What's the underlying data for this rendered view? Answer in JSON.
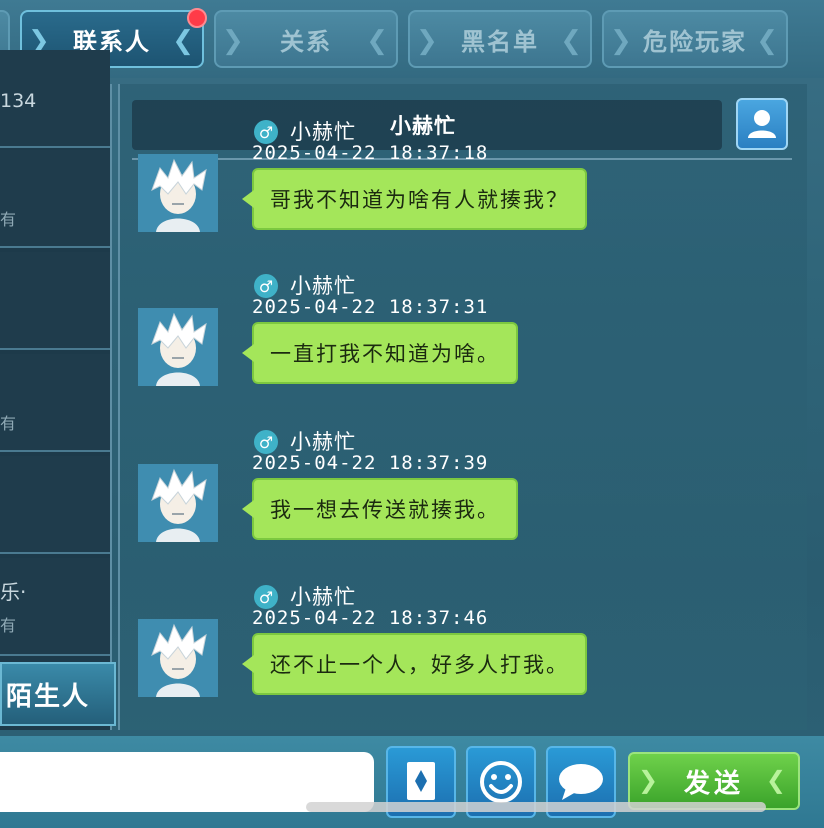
{
  "tabs": [
    {
      "label": "联系人",
      "active": true,
      "has_notification": true
    },
    {
      "label": "关系",
      "active": false
    },
    {
      "label": "黑名单",
      "active": false
    },
    {
      "label": "危险玩家",
      "active": false
    }
  ],
  "contacts": {
    "rows": [
      {
        "text": "134",
        "sub": ""
      },
      {
        "text": "",
        "sub": "有"
      },
      {
        "text": "",
        "sub": ""
      },
      {
        "text": "",
        "sub": "有"
      },
      {
        "text": "",
        "sub": ""
      },
      {
        "text": "乐·",
        "sub": "有"
      }
    ],
    "stranger_button": "陌生人"
  },
  "chat": {
    "header_name": "小赫忙",
    "messages": [
      {
        "gender": "♂",
        "name": "小赫忙",
        "time": "2025-04-22  18:37:18",
        "text": "哥我不知道为啥有人就揍我？"
      },
      {
        "gender": "♂",
        "name": "小赫忙",
        "time": "2025-04-22  18:37:31",
        "text": "一直打我不知道为啥。"
      },
      {
        "gender": "♂",
        "name": "小赫忙",
        "time": "2025-04-22  18:37:39",
        "text": "我一想去传送就揍我。"
      },
      {
        "gender": "♂",
        "name": "小赫忙",
        "time": "2025-04-22  18:37:46",
        "text": "还不止一个人，好多人打我。"
      }
    ]
  },
  "input": {
    "value": "",
    "placeholder": ""
  },
  "bottom": {
    "send_label": "发送"
  },
  "icons": {
    "profile": "user-profile-icon",
    "card": "card-icon",
    "emoji": "emoji-icon",
    "chat": "chat-bubble-icon",
    "gender": "male-gender-icon",
    "avatar": "white-hair-avatar"
  },
  "colors": {
    "bubble": "#a4e65a",
    "send": "#4bb535",
    "active_tab": "#1d5472",
    "notification": "#ff3b48"
  }
}
